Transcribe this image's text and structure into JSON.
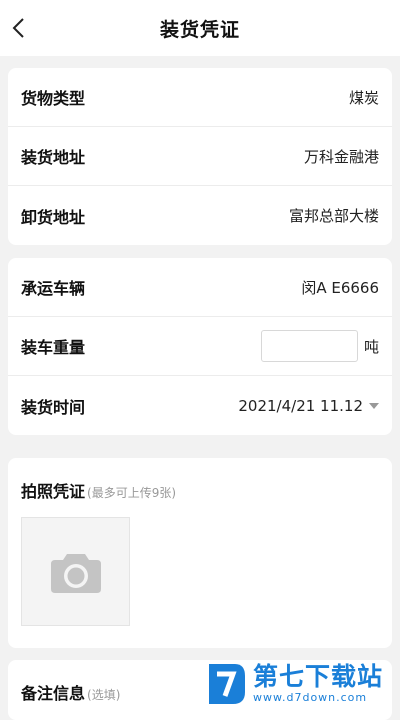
{
  "navbar": {
    "title": "装货凭证"
  },
  "cargo": {
    "type_label": "货物类型",
    "type_value": "煤炭",
    "load_label": "装货地址",
    "load_value": "万科金融港",
    "unload_label": "卸货地址",
    "unload_value": "富邦总部大楼"
  },
  "transport": {
    "vehicle_label": "承运车辆",
    "vehicle_value": "闵A E6666",
    "weight_label": "装车重量",
    "weight_value": "",
    "weight_unit": "吨",
    "time_label": "装货时间",
    "time_value": "2021/4/21 11.12"
  },
  "photo": {
    "label": "拍照凭证",
    "hint": "(最多可上传9张)"
  },
  "remark": {
    "label": "备注信息",
    "hint": "(选填)"
  },
  "watermark": {
    "title": "第七下载站",
    "url": "www.d7down.com"
  },
  "icons": {
    "back": "chevron-left-icon",
    "camera": "camera-icon",
    "caret": "caret-down-icon",
    "logo": "d7-logo-icon"
  },
  "colors": {
    "accent": "#1a7fd8",
    "background": "#f2f2f2"
  }
}
